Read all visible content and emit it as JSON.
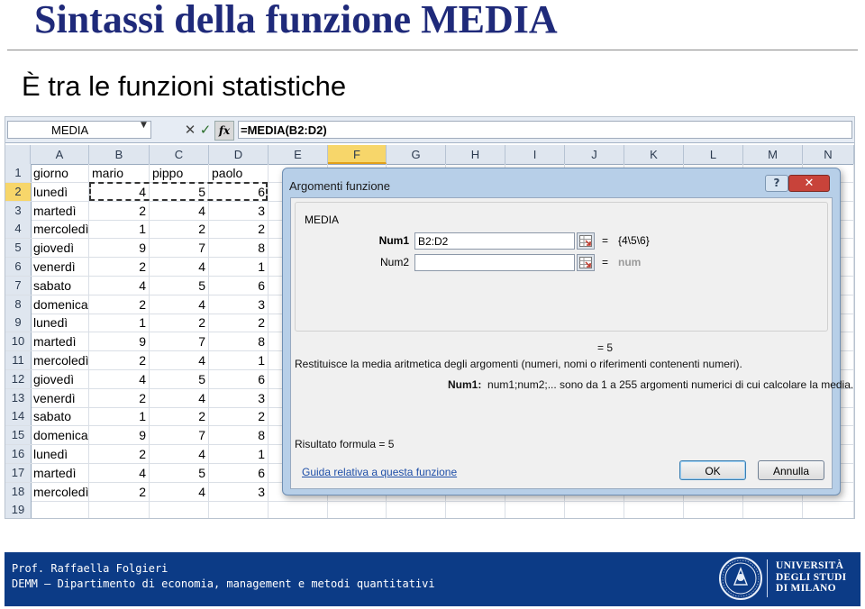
{
  "slide": {
    "title": "Sintassi della funzione MEDIA",
    "subtitle": "È tra le funzioni statistiche"
  },
  "excel": {
    "name_box": "MEDIA",
    "formula": "=MEDIA(B2:D2)",
    "cancel_symbol": "✕",
    "enter_symbol": "✓",
    "fx_label": "fx",
    "columns": [
      "A",
      "B",
      "C",
      "D",
      "E",
      "F",
      "G",
      "H",
      "I",
      "J",
      "K",
      "L",
      "M",
      "N"
    ],
    "selected_column": "F",
    "rows": [
      {
        "n": "1",
        "a": "giorno",
        "b": "mario",
        "c": "pippo",
        "d": "paolo"
      },
      {
        "n": "2",
        "a": "lunedì",
        "b": "4",
        "c": "5",
        "d": "6"
      },
      {
        "n": "3",
        "a": "martedì",
        "b": "2",
        "c": "4",
        "d": "3"
      },
      {
        "n": "4",
        "a": "mercoledì",
        "b": "1",
        "c": "2",
        "d": "2"
      },
      {
        "n": "5",
        "a": "giovedì",
        "b": "9",
        "c": "7",
        "d": "8"
      },
      {
        "n": "6",
        "a": "venerdì",
        "b": "2",
        "c": "4",
        "d": "1"
      },
      {
        "n": "7",
        "a": "sabato",
        "b": "4",
        "c": "5",
        "d": "6"
      },
      {
        "n": "8",
        "a": "domenica",
        "b": "2",
        "c": "4",
        "d": "3"
      },
      {
        "n": "9",
        "a": "lunedì",
        "b": "1",
        "c": "2",
        "d": "2"
      },
      {
        "n": "10",
        "a": "martedì",
        "b": "9",
        "c": "7",
        "d": "8"
      },
      {
        "n": "11",
        "a": "mercoledì",
        "b": "2",
        "c": "4",
        "d": "1"
      },
      {
        "n": "12",
        "a": "giovedì",
        "b": "4",
        "c": "5",
        "d": "6"
      },
      {
        "n": "13",
        "a": "venerdì",
        "b": "2",
        "c": "4",
        "d": "3"
      },
      {
        "n": "14",
        "a": "sabato",
        "b": "1",
        "c": "2",
        "d": "2"
      },
      {
        "n": "15",
        "a": "domenica",
        "b": "9",
        "c": "7",
        "d": "8"
      },
      {
        "n": "16",
        "a": "lunedì",
        "b": "2",
        "c": "4",
        "d": "1"
      },
      {
        "n": "17",
        "a": "martedì",
        "b": "4",
        "c": "5",
        "d": "6"
      },
      {
        "n": "18",
        "a": "mercoledì",
        "b": "2",
        "c": "4",
        "d": "3"
      },
      {
        "n": "19",
        "a": "",
        "b": "",
        "c": "",
        "d": ""
      }
    ]
  },
  "dialog": {
    "title": "Argomenti funzione",
    "help_symbol": "?",
    "close_symbol": "✕",
    "function_name": "MEDIA",
    "num1_label": "Num1",
    "num1_value": "B2:D2",
    "num1_result": "{4\\5\\6}",
    "num2_label": "Num2",
    "num2_value": "",
    "num2_result": "num",
    "equals": "=",
    "result_line": "= 5",
    "description": "Restituisce la media aritmetica degli argomenti (numeri, nomi o riferimenti contenenti numeri).",
    "arg_help_label": "Num1:",
    "arg_help_text": "num1;num2;... sono da 1 a 255 argomenti numerici di cui calcolare la media.",
    "formula_result": "Risultato formula =   5",
    "help_link": "Guida relativa a questa funzione",
    "ok_label": "OK",
    "cancel_label": "Annulla"
  },
  "footer": {
    "author": "Prof. Raffaella Folgieri",
    "department": "DEMM – Dipartimento di economia, management e metodi quantitativi",
    "university": [
      "UNIVERSITÀ",
      "DEGLI STUDI",
      "DI MILANO"
    ]
  },
  "colors": {
    "title": "#1f2a7a",
    "footer_bg": "#0c3b86",
    "selected_header": "#f7d66a",
    "dialog_frame": "#b7cfe8",
    "link": "#1f4fa8"
  }
}
